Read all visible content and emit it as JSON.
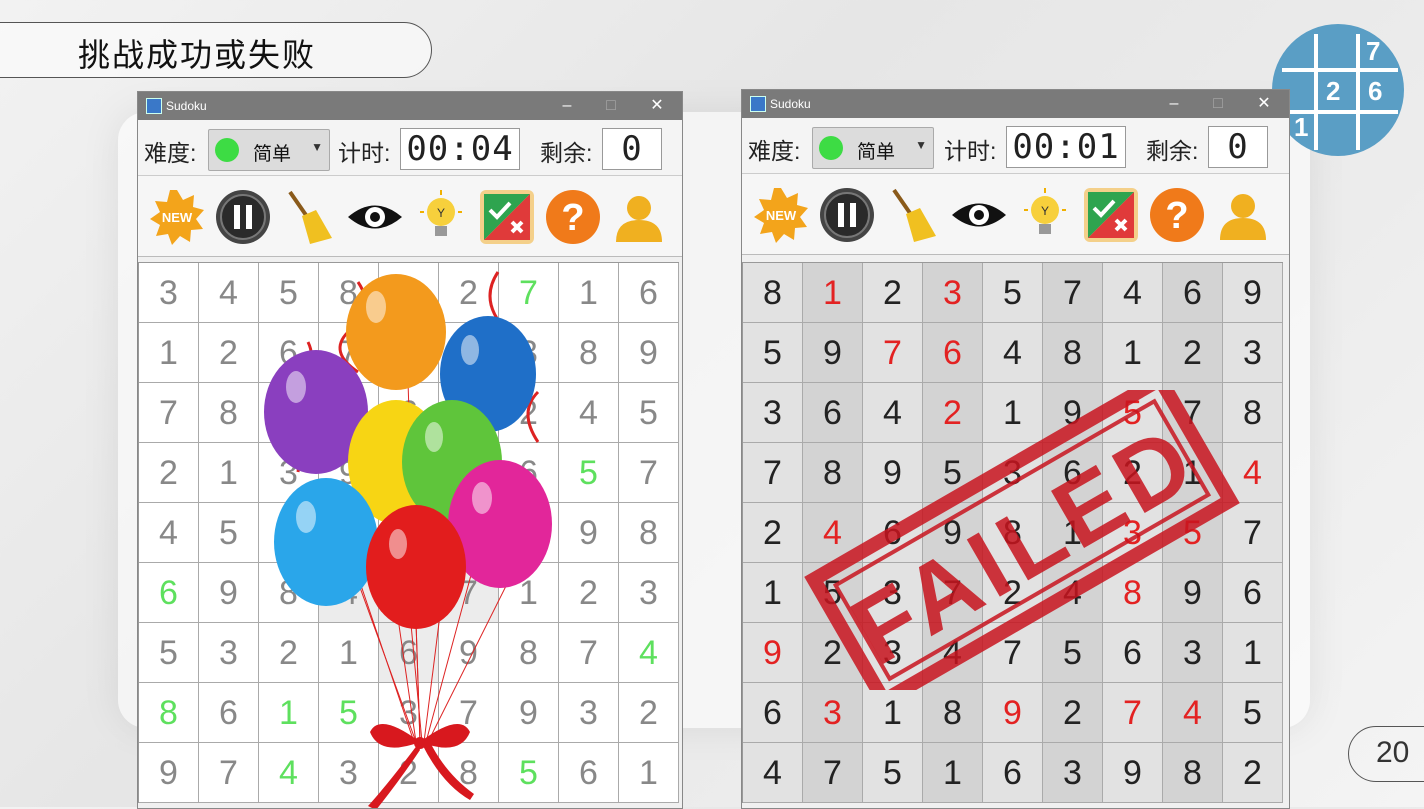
{
  "slide": {
    "title": "挑战成功或失败",
    "page_number": "20"
  },
  "logo": {
    "digits": [
      "7",
      "2",
      "6",
      "1"
    ]
  },
  "windows": [
    {
      "app_title": "Sudoku",
      "difficulty_label": "难度:",
      "difficulty_value": "简单",
      "timer_label": "计时:",
      "timer_value": "00:04",
      "remaining_label": "剩余:",
      "remaining_value": "0",
      "toolbar": [
        "new-icon",
        "pause-icon",
        "broom-icon",
        "eye-icon",
        "lightbulb-hint-icon",
        "check-cross-icon",
        "help-question-icon",
        "user-icon"
      ],
      "grid": [
        "345892716",
        "126745389",
        "789163245",
        "213984657",
        "457231698",
        "698457123",
        "532169874",
        "861537932",
        "974328561"
      ],
      "highlight": [
        "000000100",
        "000000000",
        "000000000",
        "000000010",
        "000000100",
        "100000000",
        "000000001",
        "101100000",
        "001000100"
      ],
      "overlay": "balloons"
    },
    {
      "app_title": "Sudoku",
      "difficulty_label": "难度:",
      "difficulty_value": "简单",
      "timer_label": "计时:",
      "timer_value": "00:01",
      "remaining_label": "剩余:",
      "remaining_value": "0",
      "toolbar": [
        "new-icon",
        "pause-icon",
        "broom-icon",
        "eye-icon",
        "lightbulb-hint-icon",
        "check-cross-icon",
        "help-question-icon",
        "user-icon"
      ],
      "grid": [
        "812357469",
        "597648123",
        "364219578",
        "789536214",
        "246981357",
        "153724896",
        "923475631",
        "631892745",
        "475163982"
      ],
      "highlight": [
        "010100000",
        "001100000",
        "000100100",
        "000000001",
        "010000110",
        "000000100",
        "100000000",
        "010010110",
        "000000000"
      ],
      "overlay": "FAILED"
    }
  ],
  "colors": {
    "user_digit": "#5ee05e",
    "error_digit": "#e32222",
    "stamp": "#c8141e"
  }
}
